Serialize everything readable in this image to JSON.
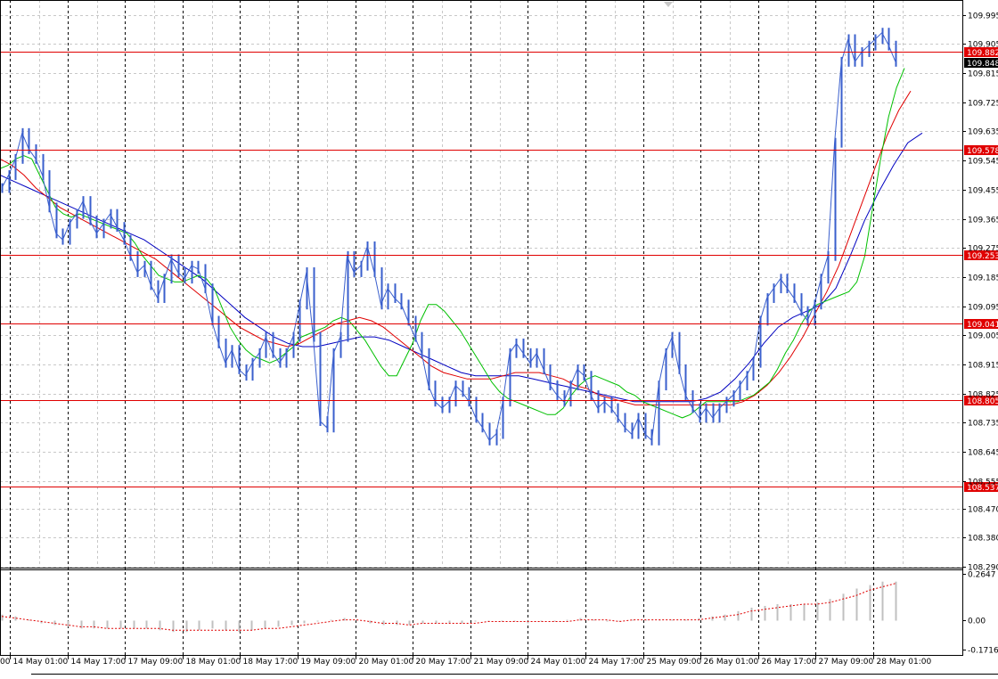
{
  "chart_data": {
    "type": "line",
    "title": "",
    "xlabel": "",
    "ylabel": "",
    "ylim": [
      108.29,
      110.03
    ],
    "grid": true,
    "y_ticks": [
      "109.995",
      "109.905",
      "109.815",
      "109.725",
      "109.635",
      "109.545",
      "109.455",
      "109.365",
      "109.275",
      "109.185",
      "109.095",
      "109.005",
      "108.915",
      "108.825",
      "108.735",
      "108.645",
      "108.555",
      "108.470",
      "108.380",
      "108.290"
    ],
    "x_ticks": [
      "14 May 01:00",
      "14 May 17:00",
      "17 May 09:00",
      "18 May 01:00",
      "18 May 17:00",
      "19 May 09:00",
      "20 May 01:00",
      "20 May 17:00",
      "21 May 09:00",
      "24 May 01:00",
      "24 May 17:00",
      "25 May 09:00",
      "26 May 01:00",
      "26 May 17:00",
      "27 May 09:00",
      "28 May 01:00"
    ],
    "x_tick_partial_left": "00",
    "price": [
      109.46,
      109.5,
      109.55,
      109.63,
      109.58,
      109.55,
      109.5,
      109.4,
      109.32,
      109.3,
      109.35,
      109.38,
      109.42,
      109.36,
      109.32,
      109.35,
      109.38,
      109.34,
      109.3,
      109.25,
      109.2,
      109.22,
      109.16,
      109.12,
      109.18,
      109.24,
      109.2,
      109.18,
      109.22,
      109.21,
      109.15,
      109.05,
      108.98,
      108.92,
      108.96,
      108.9,
      108.88,
      108.92,
      108.95,
      109.0,
      108.95,
      108.92,
      108.95,
      109.0,
      109.1,
      109.2,
      109.0,
      108.74,
      108.72,
      108.95,
      109.0,
      109.25,
      109.2,
      109.22,
      109.28,
      109.2,
      109.1,
      109.15,
      109.12,
      109.1,
      109.05,
      109.0,
      108.95,
      108.85,
      108.8,
      108.78,
      108.8,
      108.85,
      108.83,
      108.8,
      108.75,
      108.72,
      108.68,
      108.7,
      108.8,
      108.95,
      108.98,
      108.95,
      108.92,
      108.95,
      108.9,
      108.85,
      108.82,
      108.8,
      108.85,
      108.9,
      108.88,
      108.82,
      108.78,
      108.8,
      108.78,
      108.75,
      108.72,
      108.7,
      108.75,
      108.7,
      108.68,
      108.85,
      108.95,
      109.0,
      108.9,
      108.82,
      108.78,
      108.75,
      108.78,
      108.75,
      108.78,
      108.8,
      108.82,
      108.85,
      108.88,
      108.92,
      109.05,
      109.12,
      109.15,
      109.18,
      109.15,
      109.12,
      109.08,
      109.05,
      109.1,
      109.18,
      109.25,
      109.6,
      109.85,
      109.92,
      109.85,
      109.88,
      109.9,
      109.92,
      109.94,
      109.9,
      109.85
    ],
    "ma_fast": [
      109.52,
      109.53,
      109.55,
      109.56,
      109.55,
      109.5,
      109.45,
      109.4,
      109.38,
      109.37,
      109.38,
      109.37,
      109.36,
      109.35,
      109.34,
      109.33,
      109.32,
      109.29,
      109.25,
      109.22,
      109.19,
      109.18,
      109.17,
      109.17,
      109.18,
      109.19,
      109.18,
      109.15,
      109.09,
      109.03,
      108.99,
      108.96,
      108.94,
      108.93,
      108.92,
      108.93,
      108.95,
      108.97,
      109.0,
      109.01,
      109.02,
      109.03,
      109.05,
      109.06,
      109.05,
      109.02,
      108.99,
      108.95,
      108.91,
      108.88,
      108.88,
      108.93,
      108.98,
      109.05,
      109.1,
      109.1,
      109.08,
      109.05,
      109.02,
      108.98,
      108.94,
      108.9,
      108.86,
      108.83,
      108.81,
      108.8,
      108.79,
      108.78,
      108.77,
      108.76,
      108.76,
      108.78,
      108.82,
      108.85,
      108.87,
      108.88,
      108.87,
      108.86,
      108.85,
      108.83,
      108.82,
      108.8,
      108.79,
      108.78,
      108.77,
      108.76,
      108.75,
      108.76,
      108.78,
      108.8,
      108.8,
      108.8,
      108.8,
      108.8,
      108.81,
      108.82,
      108.84,
      108.86,
      108.9,
      108.95,
      108.99,
      109.04,
      109.08,
      109.1,
      109.11,
      109.12,
      109.13,
      109.14,
      109.17,
      109.25,
      109.4,
      109.55,
      109.68,
      109.77,
      109.83
    ],
    "ma_mid": [
      109.55,
      109.53,
      109.5,
      109.46,
      109.43,
      109.4,
      109.38,
      109.36,
      109.34,
      109.32,
      109.3,
      109.28,
      109.26,
      109.24,
      109.21,
      109.18,
      109.15,
      109.12,
      109.09,
      109.06,
      109.03,
      109.01,
      108.99,
      108.98,
      108.97,
      108.98,
      109.0,
      109.02,
      109.04,
      109.05,
      109.06,
      109.05,
      109.03,
      109.0,
      108.97,
      108.94,
      108.91,
      108.89,
      108.88,
      108.87,
      108.87,
      108.87,
      108.88,
      108.89,
      108.89,
      108.89,
      108.88,
      108.87,
      108.85,
      108.84,
      108.82,
      108.81,
      108.8,
      108.79,
      108.79,
      108.79,
      108.79,
      108.79,
      108.79,
      108.79,
      108.79,
      108.79,
      108.8,
      108.82,
      108.85,
      108.89,
      108.94,
      109.0,
      109.07,
      109.14,
      109.22,
      109.32,
      109.42,
      109.52,
      109.62,
      109.7,
      109.76
    ],
    "ma_slow": [
      109.5,
      109.48,
      109.46,
      109.44,
      109.42,
      109.4,
      109.38,
      109.36,
      109.34,
      109.32,
      109.3,
      109.27,
      109.24,
      109.21,
      109.18,
      109.14,
      109.1,
      109.06,
      109.03,
      109.0,
      108.98,
      108.97,
      108.97,
      108.98,
      108.99,
      109.0,
      109.0,
      108.99,
      108.97,
      108.95,
      108.93,
      108.91,
      108.89,
      108.88,
      108.88,
      108.88,
      108.88,
      108.87,
      108.86,
      108.85,
      108.84,
      108.83,
      108.82,
      108.81,
      108.8,
      108.8,
      108.8,
      108.8,
      108.8,
      108.81,
      108.83,
      108.87,
      108.92,
      108.98,
      109.03,
      109.06,
      109.08,
      109.1,
      109.15,
      109.25,
      109.36,
      109.45,
      109.53,
      109.6,
      109.63
    ],
    "price_lines": [
      {
        "value": "109.882",
        "color": "#e00000"
      },
      {
        "value": "109.578",
        "color": "#e00000"
      },
      {
        "value": "109.253",
        "color": "#e00000"
      },
      {
        "value": "109.041",
        "color": "#e00000"
      },
      {
        "value": "108.805",
        "color": "#e00000"
      },
      {
        "value": "108.537",
        "color": "#e00000"
      }
    ],
    "current_price": "109.848",
    "colors": {
      "price": "#3a5fcd",
      "ma_fast": "#00c000",
      "ma_mid": "#e00000",
      "ma_slow": "#0000c0",
      "price_line": "#e00000",
      "current_bg": "#000000"
    },
    "oscillator": {
      "type": "histogram",
      "y_ticks": [
        "0.2647",
        "0.00",
        "-0.1716"
      ],
      "ylim": [
        -0.1716,
        0.2647
      ],
      "values": [
        0.03,
        0.02,
        0.0,
        -0.02,
        -0.03,
        -0.04,
        -0.05,
        -0.05,
        -0.05,
        -0.05,
        -0.05,
        -0.05,
        -0.06,
        -0.07,
        -0.07,
        -0.06,
        -0.05,
        -0.06,
        -0.07,
        -0.06,
        -0.05,
        -0.04,
        -0.03,
        -0.02,
        -0.01,
        0.0,
        0.01,
        0.0,
        -0.02,
        -0.03,
        -0.03,
        -0.03,
        -0.02,
        -0.02,
        -0.02,
        -0.02,
        -0.01,
        -0.01,
        -0.01,
        -0.01,
        -0.02,
        -0.01,
        -0.01,
        0.0,
        0.01,
        0.0,
        -0.01,
        -0.01,
        0.0,
        0.0,
        0.0,
        0.0,
        0.0,
        0.01,
        0.02,
        0.03,
        0.05,
        0.07,
        0.08,
        0.09,
        0.09,
        0.09,
        0.1,
        0.12,
        0.15,
        0.18,
        0.2,
        0.22,
        0.22
      ],
      "signal": [
        0.02,
        0.01,
        0.0,
        -0.01,
        -0.02,
        -0.03,
        -0.04,
        -0.04,
        -0.05,
        -0.05,
        -0.05,
        -0.05,
        -0.05,
        -0.06,
        -0.06,
        -0.06,
        -0.06,
        -0.06,
        -0.06,
        -0.06,
        -0.05,
        -0.05,
        -0.04,
        -0.03,
        -0.02,
        -0.01,
        0.0,
        0.0,
        -0.01,
        -0.02,
        -0.02,
        -0.03,
        -0.02,
        -0.02,
        -0.02,
        -0.02,
        -0.02,
        -0.01,
        -0.01,
        -0.01,
        -0.01,
        -0.01,
        -0.01,
        -0.01,
        0.0,
        0.0,
        0.0,
        -0.01,
        0.0,
        0.0,
        0.0,
        0.0,
        0.0,
        0.0,
        0.01,
        0.02,
        0.03,
        0.05,
        0.06,
        0.07,
        0.08,
        0.09,
        0.09,
        0.1,
        0.12,
        0.14,
        0.17,
        0.19,
        0.21
      ],
      "colors": {
        "bars": "#c0c0c0",
        "signal": "#e00000"
      }
    }
  }
}
